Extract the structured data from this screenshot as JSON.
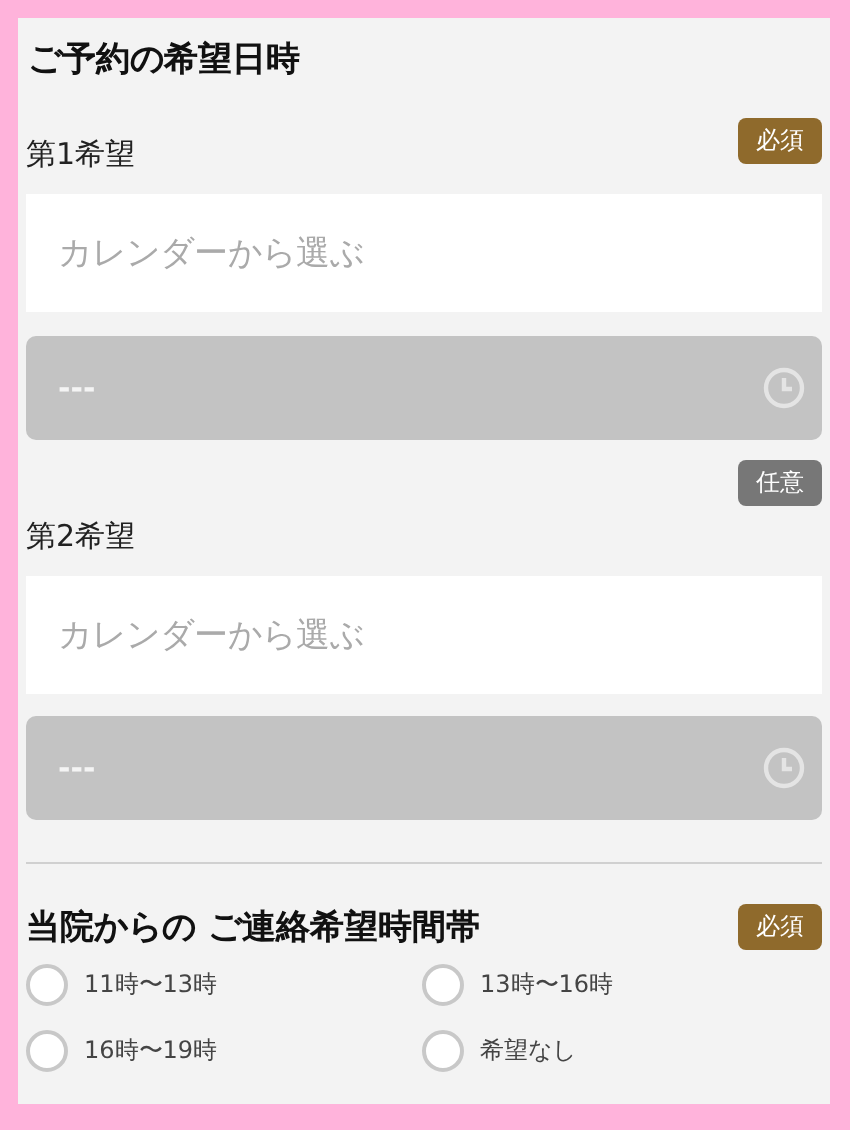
{
  "title": "ご予約の希望日時",
  "choices": [
    {
      "label": "第1希望",
      "badge": {
        "kind": "required",
        "text": "必須"
      },
      "date_field": {
        "placeholder": "カレンダーから選ぶ"
      },
      "time_field": {
        "value": "---",
        "disabled": true
      }
    },
    {
      "label": "第2希望",
      "badge": {
        "kind": "optional",
        "text": "任意"
      },
      "date_field": {
        "placeholder": "カレンダーから選ぶ"
      },
      "time_field": {
        "value": "---",
        "disabled": true
      }
    }
  ],
  "contact": {
    "title": "当院からの ご連絡希望時間帯",
    "badge": {
      "kind": "required",
      "text": "必須"
    },
    "options": [
      {
        "label": "11時〜13時",
        "selected": false
      },
      {
        "label": "13時〜16時",
        "selected": false
      },
      {
        "label": "16時〜19時",
        "selected": false
      },
      {
        "label": "希望なし",
        "selected": false
      }
    ]
  }
}
